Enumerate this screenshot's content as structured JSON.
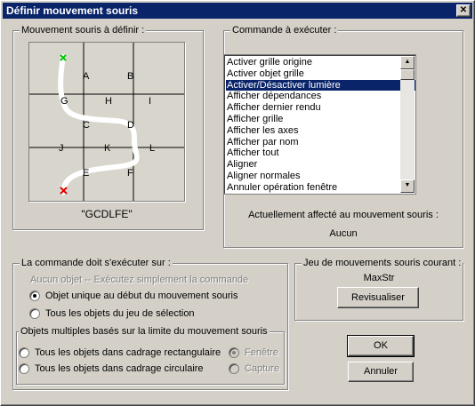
{
  "window": {
    "title": "Définir mouvement souris",
    "close_glyph": "✕"
  },
  "stroke_group": {
    "label": "Mouvement souris à définir :",
    "grid_letters": [
      "A",
      "B",
      "G",
      "H",
      "I",
      "C",
      "D",
      "J",
      "K",
      "L",
      "E",
      "F"
    ],
    "pattern": "\"GCDLFE\""
  },
  "command_group": {
    "label": "Commande à exécuter :",
    "items": [
      "Activer grille origine",
      "Activer objet grille",
      "Activer/Désactiver lumière",
      "Afficher dépendances",
      "Afficher dernier rendu",
      "Afficher grille",
      "Afficher les axes",
      "Afficher par nom",
      "Afficher tout",
      "Aligner",
      "Aligner normales",
      "Annuler opération fenêtre"
    ],
    "selected_index": 2,
    "assigned_label": "Actuellement affecté au mouvement souris :",
    "assigned_value": "Aucun"
  },
  "exec_group": {
    "label": "La commande doit s'exécuter sur :",
    "no_object_text": "Aucun objet -- Exécutez simplement la commande",
    "options": [
      {
        "label": "Objet unique au début du mouvement souris",
        "checked": true
      },
      {
        "label": "Tous les objets du jeu de sélection",
        "checked": false
      }
    ],
    "multi_group": {
      "label": "Objets multiples basés sur la limite du mouvement souris",
      "options": [
        {
          "label": "Tous les objets dans cadrage rectangulaire",
          "checked": false
        },
        {
          "label": "Tous les objets dans cadrage circulaire",
          "checked": false
        }
      ],
      "side_options": [
        {
          "label": "Fenêtre",
          "checked": true
        },
        {
          "label": "Capture",
          "checked": false
        }
      ]
    }
  },
  "set_group": {
    "label": "Jeu de mouvements souris courant :",
    "value": "MaxStr",
    "refresh_button": "Revisualiser"
  },
  "buttons": {
    "ok": "OK",
    "cancel": "Annuler"
  },
  "icons": {
    "start_marker": "green-check-icon",
    "end_marker": "red-x-icon"
  },
  "colors": {
    "titlebar": "#0a246a",
    "selection": "#0a246a",
    "grid_bg": "#d8d5cc",
    "start": "#00c800",
    "end": "#e00000"
  }
}
